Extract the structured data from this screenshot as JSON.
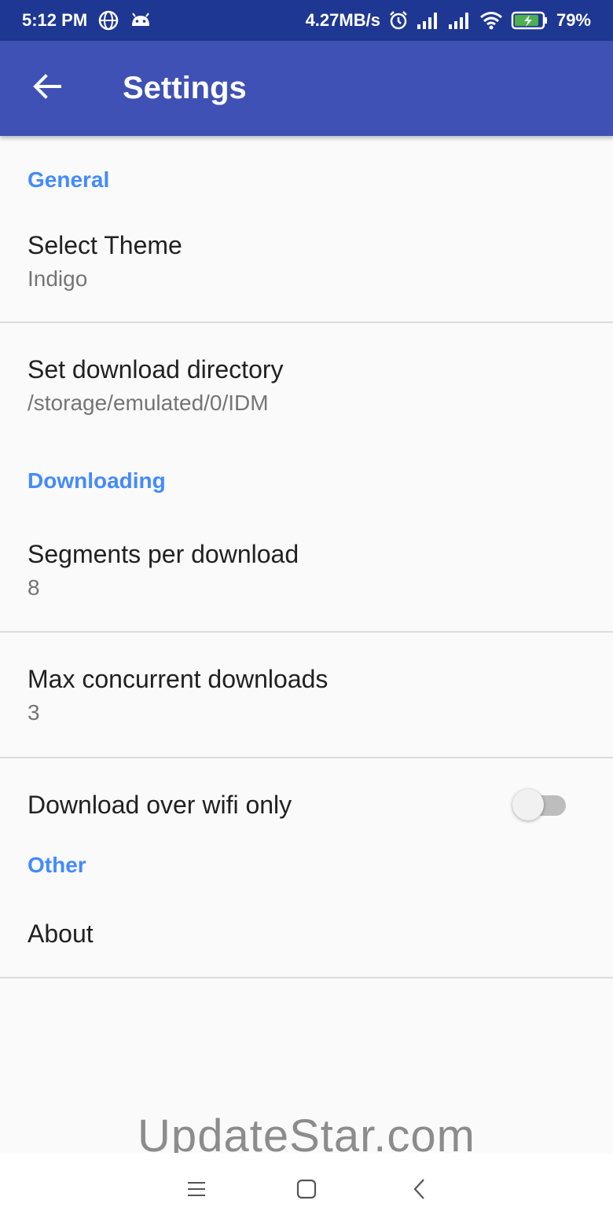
{
  "status_bar": {
    "time": "5:12 PM",
    "net_speed": "4.27MB/s",
    "battery": "79%",
    "icons": [
      "globe-icon",
      "android-icon",
      "alarm-icon",
      "signal-icon",
      "signal-icon",
      "wifi-icon",
      "battery-charging-icon"
    ]
  },
  "app_bar": {
    "back_icon": "arrow-back-icon",
    "title": "Settings",
    "color": "#3f51b5"
  },
  "sections": {
    "general": {
      "header": "General",
      "theme": {
        "title": "Select Theme",
        "summary": "Indigo"
      },
      "directory": {
        "title": "Set download directory",
        "summary": "/storage/emulated/0/IDM"
      }
    },
    "downloading": {
      "header": "Downloading",
      "segments": {
        "title": "Segments per download",
        "summary": "8"
      },
      "concurrent": {
        "title": "Max concurrent downloads",
        "summary": "3"
      },
      "wifi_only": {
        "title": "Download over wifi only",
        "enabled": false
      }
    },
    "other": {
      "header": "Other",
      "about": {
        "title": "About"
      }
    }
  },
  "accent_color": "#448aff",
  "watermark": "UpdateStar.com",
  "nav_bar": {
    "icons": [
      "menu-icon",
      "home-icon",
      "back-icon"
    ]
  }
}
